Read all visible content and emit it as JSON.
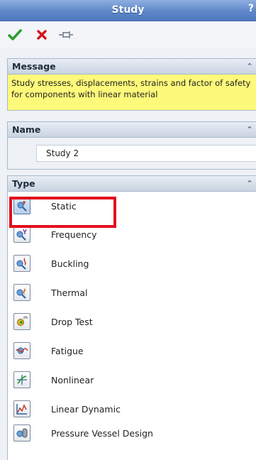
{
  "window": {
    "title": "Study",
    "help": "?"
  },
  "toolbar": {
    "ok_icon": "checkmark-icon",
    "cancel_icon": "x-icon",
    "pin_icon": "pushpin-icon"
  },
  "message": {
    "header": "Message",
    "text": "Study stresses, displacements, strains and factor of safety  for components with linear material"
  },
  "name": {
    "header": "Name",
    "value": "Study 2"
  },
  "type": {
    "header": "Type",
    "items": [
      {
        "label": "Static",
        "icon": "static-study-icon",
        "selected": true
      },
      {
        "label": "Frequency",
        "icon": "frequency-study-icon",
        "selected": false
      },
      {
        "label": "Buckling",
        "icon": "buckling-study-icon",
        "selected": false
      },
      {
        "label": "Thermal",
        "icon": "thermal-study-icon",
        "selected": false
      },
      {
        "label": "Drop Test",
        "icon": "drop-test-study-icon",
        "selected": false
      },
      {
        "label": "Fatigue",
        "icon": "fatigue-study-icon",
        "selected": false
      },
      {
        "label": "Nonlinear",
        "icon": "nonlinear-study-icon",
        "selected": false
      },
      {
        "label": "Linear Dynamic",
        "icon": "linear-dynamic-study-icon",
        "selected": false
      },
      {
        "label": "Pressure Vessel Design",
        "icon": "pressure-vessel-study-icon",
        "selected": false
      }
    ]
  },
  "colors": {
    "accent": "#5e87c9",
    "message_bg": "#fdf97a",
    "highlight": "#e3101b"
  }
}
